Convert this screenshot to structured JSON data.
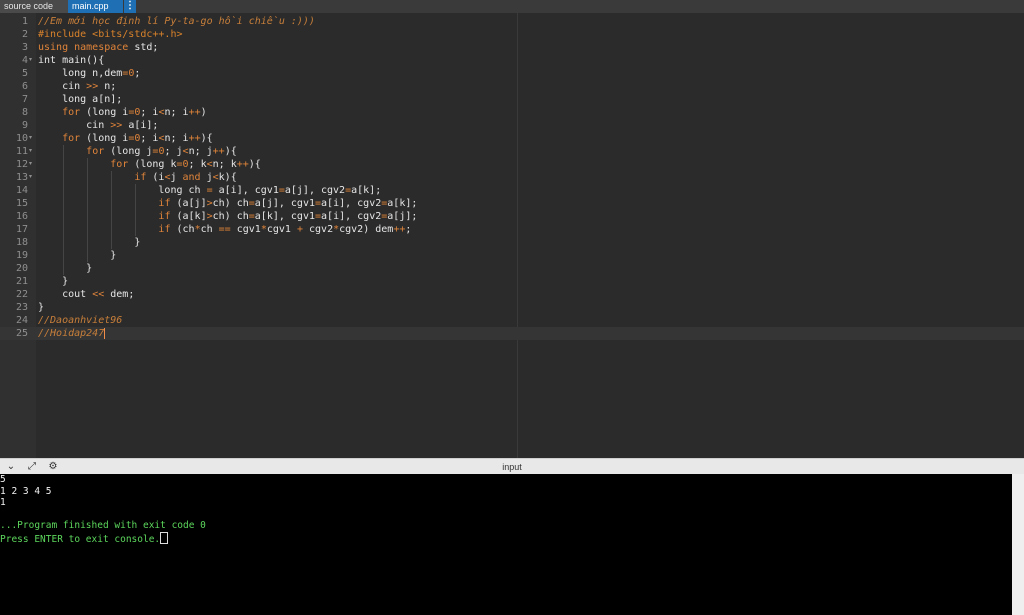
{
  "tabs": {
    "source_label": "source code",
    "file_label": "main.cpp",
    "menu_glyph": "⋮"
  },
  "editor": {
    "active_line": 25,
    "lines": [
      {
        "n": "1",
        "fold": "",
        "html": "<span class='cm'>//Em mới học định lí Py-ta-go hồi chiều :)))</span>",
        "guides": []
      },
      {
        "n": "2",
        "fold": "",
        "html": "<span class='pp'>#include &lt;bits/stdc++.h&gt;</span>",
        "guides": []
      },
      {
        "n": "3",
        "fold": "",
        "html": "<span class='kw'>using namespace</span> std;",
        "guides": []
      },
      {
        "n": "4",
        "fold": "▾",
        "html": "int main(){",
        "guides": []
      },
      {
        "n": "5",
        "fold": "",
        "html": "    long n,dem<span class='op'>=</span><span class='num'>0</span>;",
        "guides": []
      },
      {
        "n": "6",
        "fold": "",
        "html": "    cin <span class='op'>&gt;&gt;</span> n;",
        "guides": []
      },
      {
        "n": "7",
        "fold": "",
        "html": "    long a[n];",
        "guides": []
      },
      {
        "n": "8",
        "fold": "",
        "html": "    <span class='kw'>for</span> (long i<span class='op'>=</span><span class='num'>0</span>; i<span class='op'>&lt;</span>n; i<span class='op'>++</span>)",
        "guides": []
      },
      {
        "n": "9",
        "fold": "",
        "html": "        cin <span class='op'>&gt;&gt;</span> a[i];",
        "guides": []
      },
      {
        "n": "10",
        "fold": "▾",
        "html": "    <span class='kw'>for</span> (long i<span class='op'>=</span><span class='num'>0</span>; i<span class='op'>&lt;</span>n; i<span class='op'>++</span>){",
        "guides": []
      },
      {
        "n": "11",
        "fold": "▾",
        "html": "        <span class='kw'>for</span> (long j<span class='op'>=</span><span class='num'>0</span>; j<span class='op'>&lt;</span>n; j<span class='op'>++</span>){",
        "guides": [
          1
        ]
      },
      {
        "n": "12",
        "fold": "▾",
        "html": "            <span class='kw'>for</span> (long k<span class='op'>=</span><span class='num'>0</span>; k<span class='op'>&lt;</span>n; k<span class='op'>++</span>){",
        "guides": [
          1,
          2
        ]
      },
      {
        "n": "13",
        "fold": "▾",
        "html": "                <span class='kw'>if</span> (i<span class='op'>&lt;</span>j <span class='kw'>and</span> j<span class='op'>&lt;</span>k){",
        "guides": [
          1,
          2,
          3
        ]
      },
      {
        "n": "14",
        "fold": "",
        "html": "                    long ch <span class='op'>=</span> a[i], cgv1<span class='op'>=</span>a[j], cgv2<span class='op'>=</span>a[k];",
        "guides": [
          1,
          2,
          3,
          4
        ]
      },
      {
        "n": "15",
        "fold": "",
        "html": "                    <span class='kw'>if</span> (a[j]<span class='op'>&gt;</span>ch) ch<span class='op'>=</span>a[j], cgv1<span class='op'>=</span>a[i], cgv2<span class='op'>=</span>a[k];",
        "guides": [
          1,
          2,
          3,
          4
        ]
      },
      {
        "n": "16",
        "fold": "",
        "html": "                    <span class='kw'>if</span> (a[k]<span class='op'>&gt;</span>ch) ch<span class='op'>=</span>a[k], cgv1<span class='op'>=</span>a[i], cgv2<span class='op'>=</span>a[j];",
        "guides": [
          1,
          2,
          3,
          4
        ]
      },
      {
        "n": "17",
        "fold": "",
        "html": "                    <span class='kw'>if</span> (ch<span class='op'>*</span>ch <span class='op'>==</span> cgv1<span class='op'>*</span>cgv1 <span class='op'>+</span> cgv2<span class='op'>*</span>cgv2) dem<span class='op'>++</span>;",
        "guides": [
          1,
          2,
          3,
          4
        ]
      },
      {
        "n": "18",
        "fold": "",
        "html": "                }",
        "guides": [
          1,
          2,
          3
        ]
      },
      {
        "n": "19",
        "fold": "",
        "html": "            }",
        "guides": [
          1,
          2
        ]
      },
      {
        "n": "20",
        "fold": "",
        "html": "        }",
        "guides": [
          1
        ]
      },
      {
        "n": "21",
        "fold": "",
        "html": "    }",
        "guides": []
      },
      {
        "n": "22",
        "fold": "",
        "html": "    cout <span class='op'>&lt;&lt;</span> dem;",
        "guides": []
      },
      {
        "n": "23",
        "fold": "",
        "html": "}",
        "guides": []
      },
      {
        "n": "24",
        "fold": "",
        "html": "<span class='cm'>//Daoanhviet96</span>",
        "guides": []
      },
      {
        "n": "25",
        "fold": "",
        "html": "<span class='cm'>//Hoidap247</span><span class='cursor'></span>",
        "guides": []
      }
    ]
  },
  "io": {
    "label": "input",
    "collapse_glyph": "⌄",
    "expand_glyph": "⤢",
    "settings_glyph": "⚙"
  },
  "console": {
    "lines": [
      {
        "text": "5",
        "style": "in"
      },
      {
        "text": "1 2 3 4 5",
        "style": "in"
      },
      {
        "text": "1",
        "style": "in"
      },
      {
        "text": "",
        "style": "in"
      },
      {
        "text": "...Program finished with exit code 0",
        "style": "ok"
      },
      {
        "text": "Press ENTER to exit console.",
        "style": "ok",
        "cursor": true
      }
    ]
  }
}
